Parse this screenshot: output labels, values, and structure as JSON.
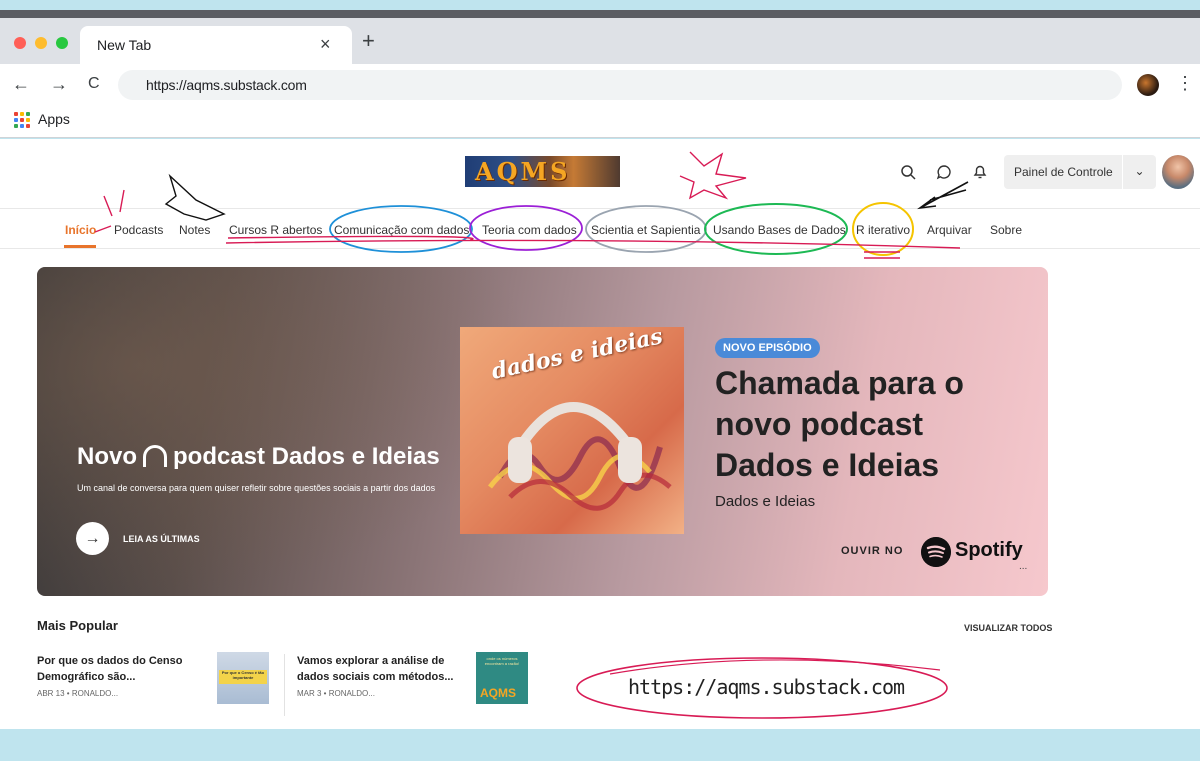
{
  "browser": {
    "tab_title": "New Tab",
    "tab_close": "×",
    "new_tab": "+",
    "back": "←",
    "forward": "→",
    "reload": "C",
    "url": "https://aqms.substack.com",
    "menu": "⋮",
    "bookmark_apps": "Apps"
  },
  "site": {
    "logo_text": "AQMS",
    "dashboard_label": "Painel de Controle",
    "dashboard_caret": "⌄",
    "nav": [
      "Início",
      "Podcasts",
      "Notes",
      "Cursos R abertos",
      "Comunicação com dados",
      "Teoria com dados",
      "Scientia et Sapientia",
      "Usando Bases de Dados",
      "R iterativo",
      "Arquivar",
      "Sobre"
    ]
  },
  "hero": {
    "title_part1": "Novo",
    "title_part2": "podcast Dados e Ideias",
    "subtitle": "Um canal de conversa para quem quiser refletir sobre questões sociais a partir dos dados",
    "button_arrow": "→",
    "button_label": "LEIA AS ÚLTIMAS",
    "cover_title": "dados e ideias",
    "badge": "NOVO EPISÓDIO",
    "episode_title": "Chamada para o novo podcast Dados e Ideias",
    "episode_show": "Dados e Ideias",
    "listen_on": "OUVIR NO",
    "spotify": "Spotify",
    "ellipsis": "..."
  },
  "popular": {
    "heading": "Mais Popular",
    "view_all": "VISUALIZAR TODOS",
    "posts": [
      {
        "title": "Por que os dados do Censo Demográfico são...",
        "meta": "ABR 13 • RONALDO...",
        "thumb_text": "Por que o Censo é tão importante"
      },
      {
        "title": "Vamos explorar a análise de dados sociais com métodos...",
        "meta": "MAR 3 • RONALDO...",
        "thumb_text": "onde os números encontram a razão!",
        "thumb_brand": "AQMS"
      }
    ]
  },
  "annotation": {
    "url_callout": "https://aqms.substack.com"
  },
  "colors": {
    "accent": "#e8742b",
    "badge": "#4a8ad8",
    "page_bg": "#bfe4ee"
  }
}
